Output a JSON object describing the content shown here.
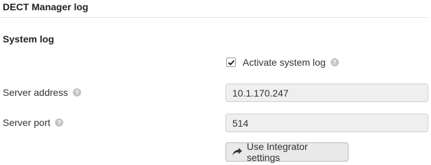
{
  "header": {
    "title": "DECT Manager log"
  },
  "system_log": {
    "title": "System log",
    "activate_checkbox": {
      "label": "Activate system log",
      "checked": true
    },
    "server_address": {
      "label": "Server address",
      "value": "10.1.170.247"
    },
    "server_port": {
      "label": "Server port",
      "value": "514"
    },
    "integrator_button": {
      "label": "Use Integrator settings",
      "icon": "share-icon"
    }
  },
  "icons": {
    "help": "?"
  },
  "colors": {
    "input_bg": "#efefef",
    "help_icon": "#c4c4c4",
    "button_bg": "#e9e9e9"
  }
}
